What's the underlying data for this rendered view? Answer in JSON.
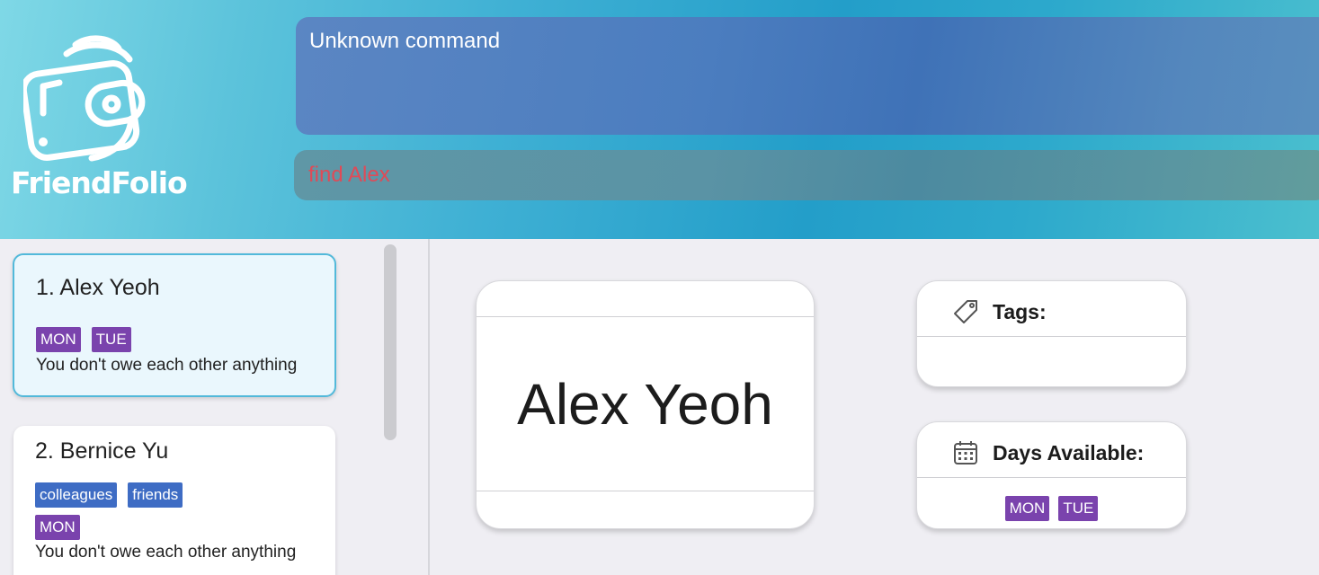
{
  "app": {
    "name": "FriendFolio"
  },
  "result": {
    "text": "Unknown command"
  },
  "command": {
    "value": "find Alex"
  },
  "persons": [
    {
      "index_name": "1.  Alex Yeoh",
      "tags": [],
      "days": [
        "MON",
        "TUE"
      ],
      "debt": "You don't owe each other anything",
      "selected": true
    },
    {
      "index_name": "2.  Bernice Yu",
      "tags": [
        "colleagues",
        "friends"
      ],
      "days": [
        "MON"
      ],
      "debt": "You don't owe each other anything",
      "selected": false
    }
  ],
  "detail": {
    "name": "Alex Yeoh",
    "tags_title": "Tags:",
    "tags": [],
    "days_title": "Days Available:",
    "days": [
      "MON",
      "TUE"
    ]
  },
  "colors": {
    "day_tag": "#7a43ad",
    "group_tag": "#3e6cc4",
    "command_text": "#e04a57",
    "selected_border": "#52b9da"
  },
  "icons": {
    "logo": "wallet-logo-icon",
    "tags": "tag-icon",
    "days": "calendar-icon"
  }
}
